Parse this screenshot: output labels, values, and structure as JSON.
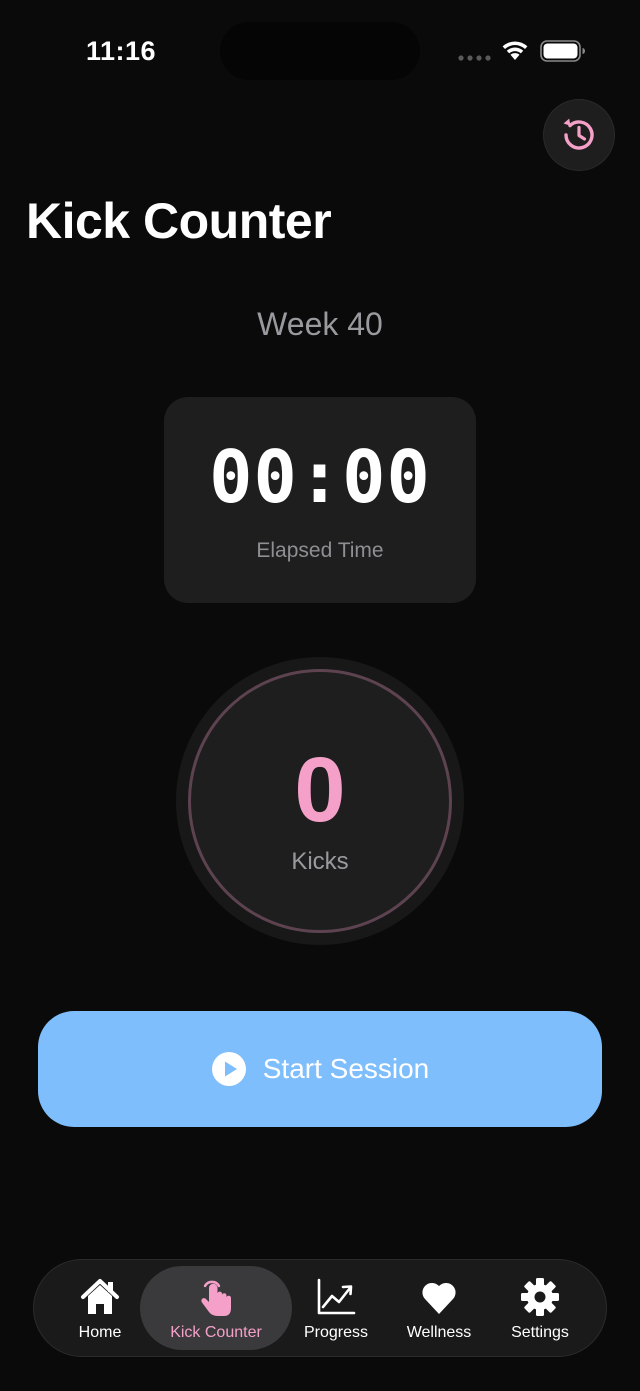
{
  "status_bar": {
    "time": "11:16"
  },
  "header": {
    "title": "Kick Counter",
    "history_icon": "history-icon"
  },
  "session": {
    "week_label": "Week 40",
    "elapsed_time": "00:00",
    "elapsed_caption": "Elapsed Time",
    "kick_count": "0",
    "kick_caption": "Kicks",
    "start_label": "Start Session"
  },
  "tabs": [
    {
      "label": "Home",
      "icon": "house-icon",
      "active": false
    },
    {
      "label": "Kick Counter",
      "icon": "hand-tap-icon",
      "active": true
    },
    {
      "label": "Progress",
      "icon": "chart-line-icon",
      "active": false
    },
    {
      "label": "Wellness",
      "icon": "heart-icon",
      "active": false
    },
    {
      "label": "Settings",
      "icon": "gear-icon",
      "active": false
    }
  ],
  "colors": {
    "background": "#0a0a0a",
    "accent_pink": "#f5a0c9",
    "button_blue": "#7fbefc",
    "card": "#1e1e1f"
  }
}
